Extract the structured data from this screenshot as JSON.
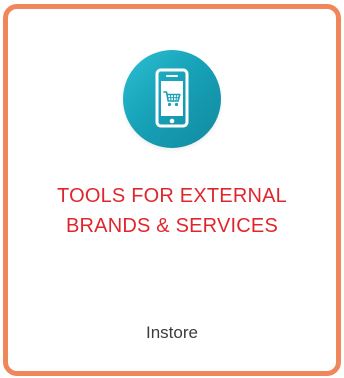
{
  "card": {
    "title_line1": "TOOLS FOR EXTERNAL",
    "title_line2": "BRANDS & SERVICES",
    "subtitle": "Instore",
    "icon": "mobile-shopping-cart-icon",
    "border_color": "#f0875a",
    "icon_bg_color": "#17a2b8",
    "title_color": "#e0262d"
  }
}
